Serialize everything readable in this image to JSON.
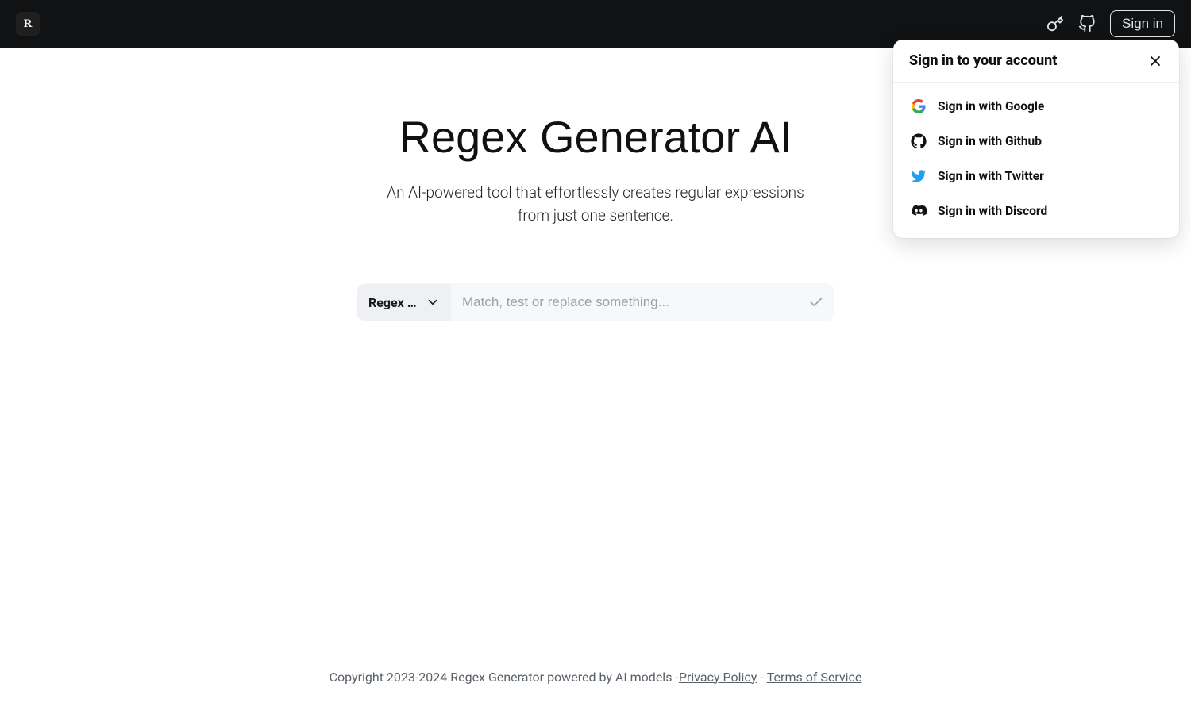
{
  "header": {
    "logo_letter": "R",
    "sign_in_label": "Sign in"
  },
  "hero": {
    "title": "Regex Generator AI",
    "subtitle": "An AI-powered tool that effortlessly creates regular expressions from just one sentence."
  },
  "input": {
    "mode_label": "Regex o…",
    "placeholder": "Match, test or replace something..."
  },
  "footer": {
    "copyright": "Copyright 2023-2024 Regex Generator powered by AI models - ",
    "privacy_label": "Privacy Policy",
    "separator": " - ",
    "terms_label": "Terms of Service"
  },
  "signin_popup": {
    "title": "Sign in to your account",
    "options": [
      {
        "label": "Sign in with Google",
        "provider": "google"
      },
      {
        "label": "Sign in with Github",
        "provider": "github"
      },
      {
        "label": "Sign in with Twitter",
        "provider": "twitter"
      },
      {
        "label": "Sign in with Discord",
        "provider": "discord"
      }
    ]
  }
}
